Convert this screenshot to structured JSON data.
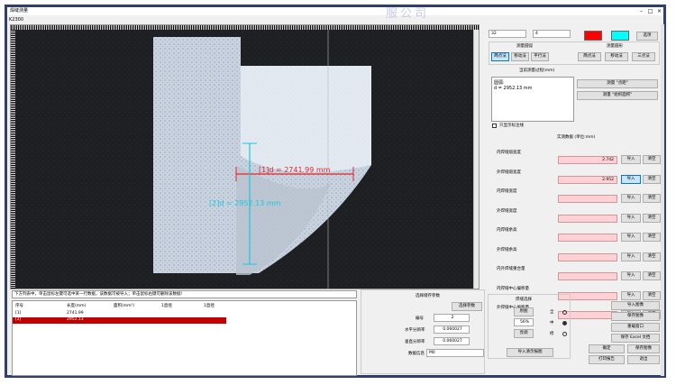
{
  "window": {
    "title": "焊缝测量",
    "subtitle": "K2300",
    "watermark": "服公司"
  },
  "toolbar": {
    "zoom_value": "32",
    "count_value": "4",
    "settings_label": "选项"
  },
  "measure": {
    "mode_label": "测量圆弧",
    "sub_a_label": "测量圆形",
    "btns_left": [
      "两点法",
      "移动法",
      "平行法"
    ],
    "btns_right": [
      "两点法",
      "移动法",
      "三点法"
    ],
    "current_label": "当前测量过程(mm)",
    "current_text_1": "圆弧:",
    "current_text_2": "d = 2952.13 mm",
    "check_label": "只显示标注线",
    "btn_point": "测量 \"点距\"",
    "btn_angle": "测量 \"组织面积\"",
    "data_label": "实测数据 (单位:mm)"
  },
  "data_rows": [
    {
      "label": "内焊缝熔宽度",
      "value": "2.742",
      "b1": "导入",
      "b2": "清空"
    },
    {
      "label": "外焊缝熔宽度",
      "value": "2.952",
      "b1": "导入",
      "b2": "清空"
    },
    {
      "label": "内焊缝宽度",
      "value": "",
      "b1": "导入",
      "b2": "清空"
    },
    {
      "label": "外焊缝宽度",
      "value": "",
      "b1": "导入",
      "b2": "清空"
    },
    {
      "label": "内焊缝余高",
      "value": "",
      "b1": "导入",
      "b2": "清空"
    },
    {
      "label": "外焊缝余高",
      "value": "",
      "b1": "导入",
      "b2": "清空"
    },
    {
      "label": "内外焊缝重合量",
      "value": "",
      "b1": "导入",
      "b2": "清空"
    },
    {
      "label": "内焊缝中心偏移量",
      "value": "",
      "b1": "导入",
      "b2": "清空"
    },
    {
      "label": "外焊缝中心偏移量",
      "value": "",
      "b1": "导入",
      "b2": "清空"
    }
  ],
  "image": {
    "annot_h": "[1]d = 2741.99 mm",
    "annot_v": "[2]d = 2952.13 mm"
  },
  "hint": "下方列表中，单击鼠标左键可选中某一行数据，该数据可被导入；单击鼠标右键可删除该数据!",
  "table": {
    "headers": [
      "序号",
      "长度(mm)",
      "面积(mm²)",
      "1直径",
      "1直径"
    ],
    "rows": [
      [
        "[1]",
        "2741.99",
        "",
        "",
        ""
      ],
      [
        "[2]",
        "2952.13",
        "",
        "",
        ""
      ]
    ]
  },
  "cal": {
    "title": "选择储存参数",
    "btn": "选择参数",
    "f1_label": "编号",
    "f1_value": "2",
    "f2_label": "水平分辨率",
    "f2_value": "0.060027",
    "f3_label": "垂直分辨率",
    "f3_value": "0.060027",
    "f4_label": "数据信息",
    "f4_value": "M0"
  },
  "weld": {
    "title": "焊缝选择",
    "b1": "原图",
    "v1": "56%",
    "b2": "亮调",
    "r1": "全",
    "r2": "中",
    "r3": "修",
    "import_btn": "导入清示报图"
  },
  "actions": {
    "a1": "导入图像",
    "a2": "保存图像",
    "a3": "重载窗口",
    "a4": "保存 Excel 文档",
    "a5": "确定",
    "a6": "保存图像",
    "a7": "打印报告",
    "a8": "退出"
  },
  "colors": {
    "red": "#ff0000",
    "cyan": "#00ffff",
    "sel_row": "#c00000",
    "annot_red": "#e8242a",
    "annot_cyan": "#1ec8d8"
  }
}
